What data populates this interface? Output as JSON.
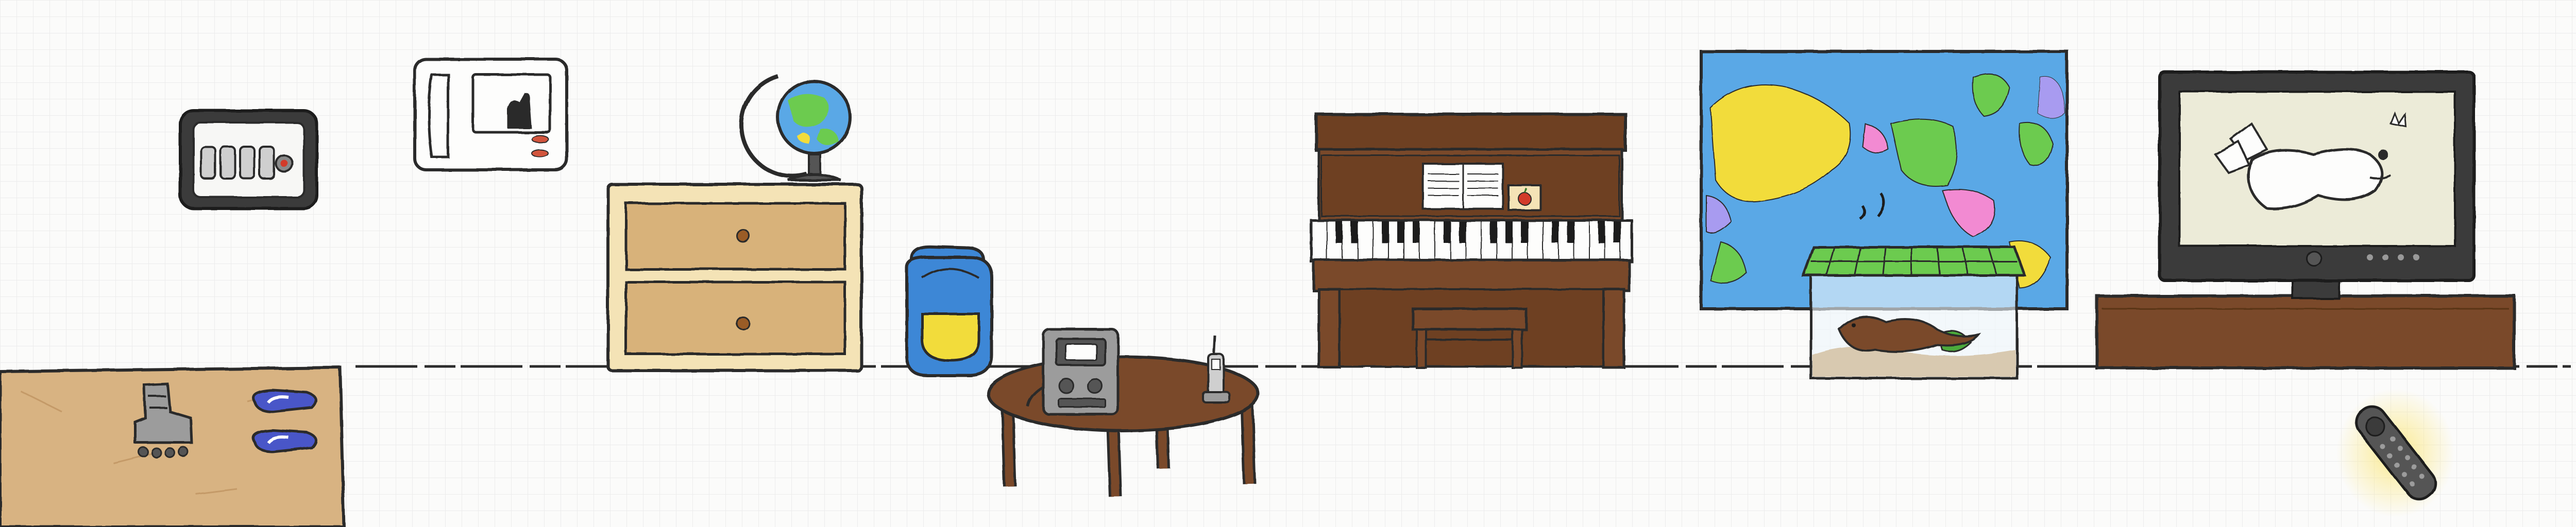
{
  "scene": {
    "type": "hand-drawn room escape scene",
    "objects": [
      "intercom-panel",
      "door-intercom-phone",
      "entryway-mat",
      "roller-skate",
      "slippers",
      "globe",
      "dresser",
      "dresser-top-drawer",
      "dresser-bottom-drawer",
      "backpack",
      "coffee-table",
      "cassette-radio",
      "cordless-phone",
      "piano",
      "sheet-music",
      "apple-card",
      "piano-bench",
      "world-map",
      "terrarium",
      "lizard",
      "tv-stand",
      "television",
      "tv-remote"
    ]
  },
  "colors": {
    "outline": "#2c2c2c",
    "wood_light": "#d8b382",
    "wood_dark": "#7a4a2a",
    "dresser_body": "#f4e3b6",
    "backpack_blue": "#3d87d6",
    "backpack_yellow": "#f2dc3a",
    "map_ocean": "#5aa8e6",
    "tv_screen": "#ecebd8",
    "remote_glow": "#f7e58a"
  }
}
